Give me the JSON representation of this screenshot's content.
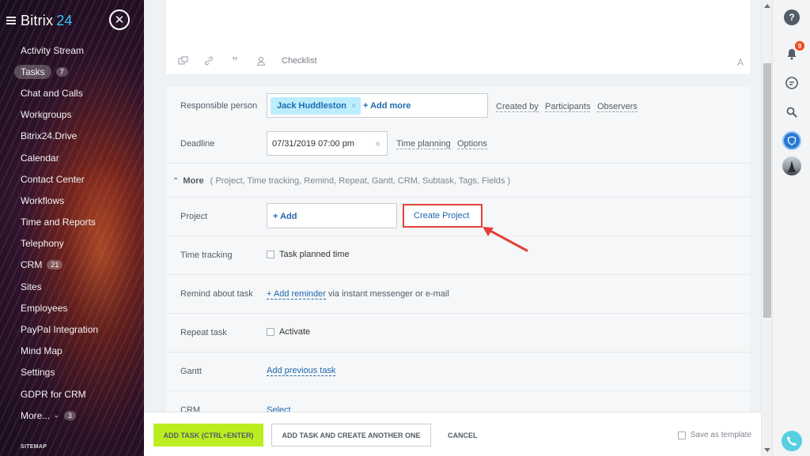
{
  "sidebar": {
    "logo_text": "Bitrix",
    "logo_num": "24",
    "items": [
      {
        "label": "Activity Stream"
      },
      {
        "label": "Tasks",
        "counter": "7",
        "active": true
      },
      {
        "label": "Chat and Calls"
      },
      {
        "label": "Workgroups"
      },
      {
        "label": "Bitrix24.Drive"
      },
      {
        "label": "Calendar"
      },
      {
        "label": "Contact Center"
      },
      {
        "label": "Workflows"
      },
      {
        "label": "Time and Reports"
      },
      {
        "label": "Telephony"
      },
      {
        "label": "CRM",
        "counter": "21"
      },
      {
        "label": "Sites"
      },
      {
        "label": "Employees"
      },
      {
        "label": "PayPal Integration"
      },
      {
        "label": "Mind Map"
      },
      {
        "label": "Settings"
      },
      {
        "label": "GDPR for CRM"
      },
      {
        "label": "More...",
        "counter": "3"
      }
    ],
    "sitemap_label": "SITEMAP"
  },
  "editor": {
    "checklist_label": "Checklist",
    "font_label": "A",
    "icons": [
      "attach-icon",
      "link-icon",
      "quote-icon",
      "mention-icon"
    ]
  },
  "form": {
    "responsible": {
      "label": "Responsible person",
      "person": "Jack Huddleston",
      "remove": "×",
      "add_more": "+ Add more",
      "links": [
        "Created by",
        "Participants",
        "Observers"
      ]
    },
    "deadline": {
      "label": "Deadline",
      "value": "07/31/2019 07:00 pm",
      "clear": "×",
      "links": [
        "Time planning",
        "Options"
      ]
    },
    "more": {
      "title": "More",
      "list": "( Project,  Time tracking,  Remind,  Repeat,  Gantt,  CRM,  Subtask,  Tags,  Fields )"
    },
    "project": {
      "label": "Project",
      "add": "+ Add",
      "create": "Create Project"
    },
    "time_tracking": {
      "label": "Time tracking",
      "checkbox_label": "Task planned time"
    },
    "remind": {
      "label": "Remind about task",
      "add": "+ Add reminder",
      "suffix": "via instant messenger or e-mail"
    },
    "repeat": {
      "label": "Repeat task",
      "checkbox_label": "Activate"
    },
    "gantt": {
      "label": "Gantt",
      "add": "Add previous task"
    },
    "crm": {
      "label": "CRM",
      "select": "Select"
    }
  },
  "footer": {
    "add_task": "ADD TASK (CTRL+ENTER)",
    "add_another": "ADD TASK AND CREATE ANOTHER ONE",
    "cancel": "CANCEL",
    "save_template": "Save as template"
  },
  "right_panel": {
    "help": "?",
    "notifications_count": "9"
  },
  "colors": {
    "accent_green": "#bbed21",
    "link_blue": "#2067b0",
    "highlight_red": "#e3413b",
    "tag_bg": "#bcedfc"
  }
}
